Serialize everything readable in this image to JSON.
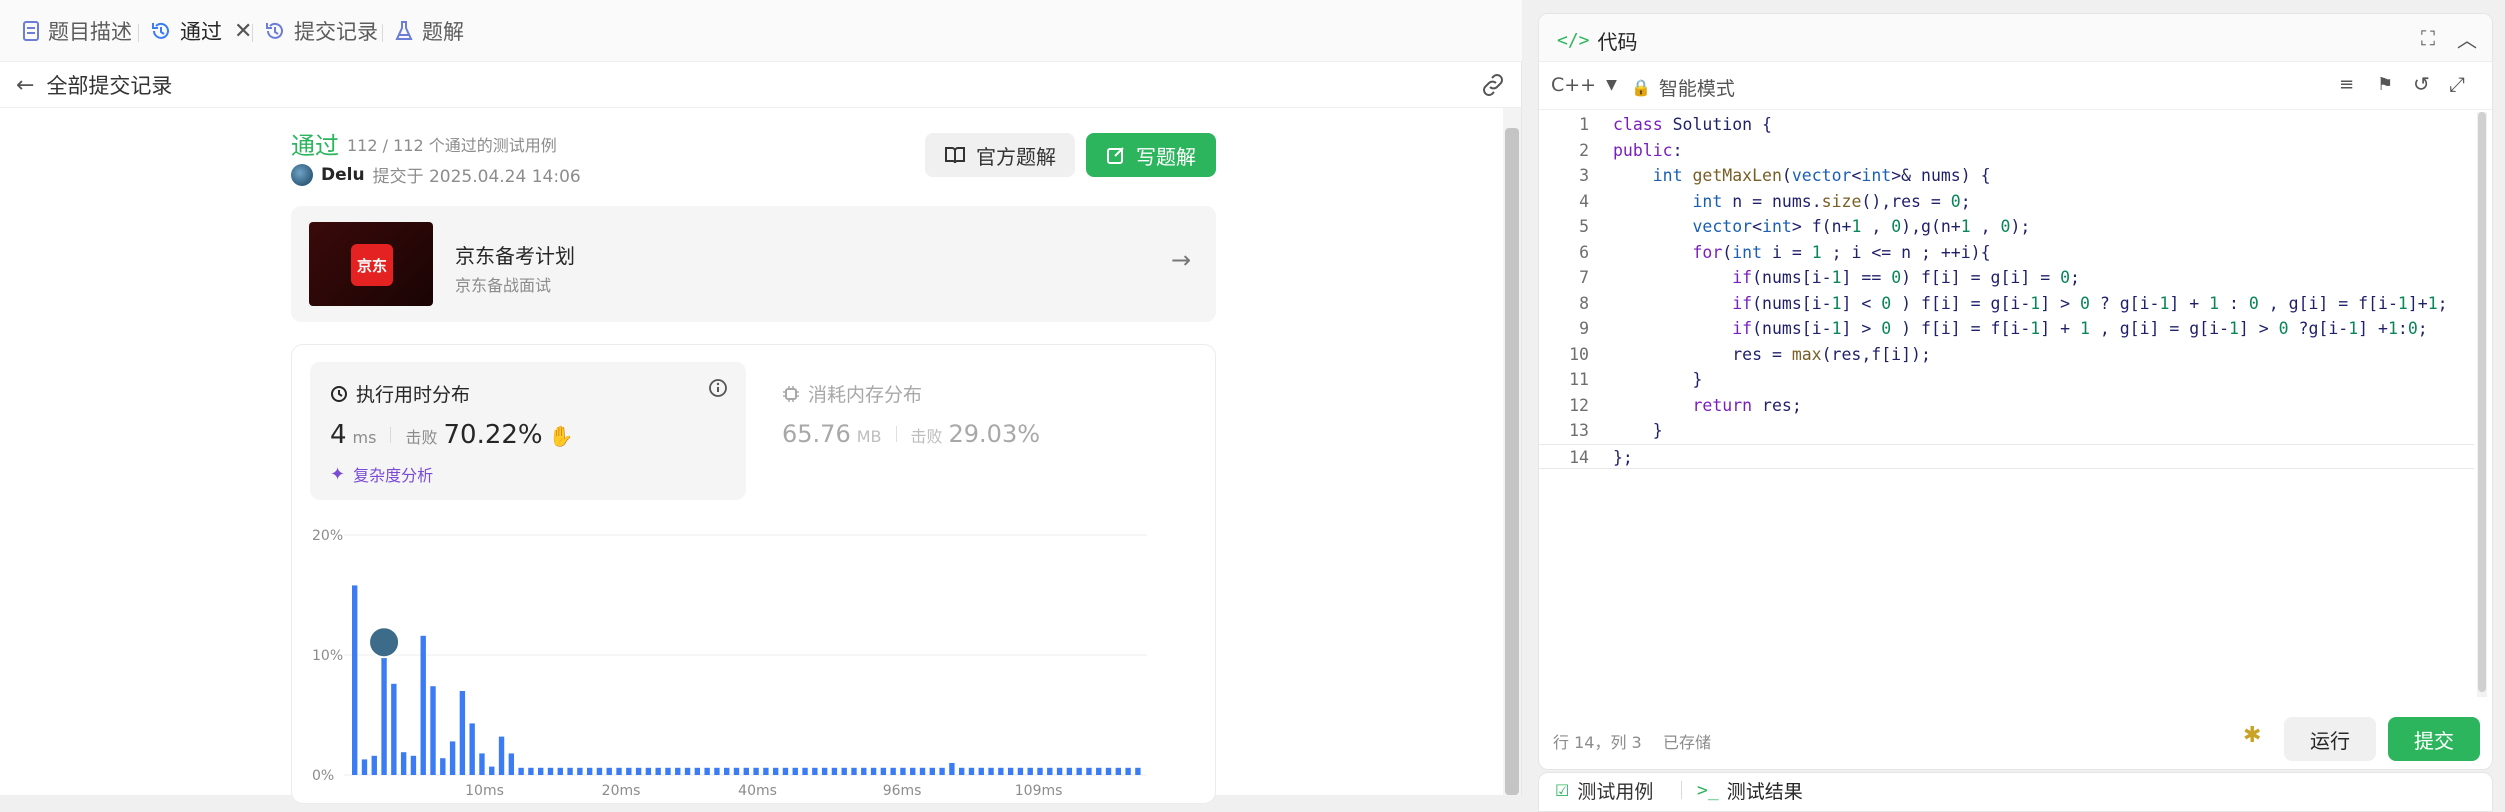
{
  "tabs": [
    {
      "label": "题目描述",
      "icon": "document-icon"
    },
    {
      "label": "通过",
      "icon": "history-icon"
    },
    {
      "label": "提交记录",
      "icon": "history-icon"
    },
    {
      "label": "题解",
      "icon": "flask-icon"
    }
  ],
  "subbar": {
    "back_label": "全部提交记录"
  },
  "result": {
    "status": "通过",
    "passed": "112 / 112 个通过的测试用例",
    "user": "Delu",
    "submitted_at": "提交于 2025.04.24 14:06",
    "official_solution_label": "官方题解",
    "write_solution_label": "写题解"
  },
  "promo": {
    "logo_text": "京东",
    "title": "京东备考计划",
    "subtitle": "京东备战面试"
  },
  "runtime": {
    "title": "执行用时分布",
    "value": "4",
    "unit": "ms",
    "beats_label": "击败",
    "beats_value": "70.22%",
    "analysis_label": "复杂度分析"
  },
  "memory": {
    "title": "消耗内存分布",
    "value": "65.76",
    "unit": "MB",
    "beats_label": "击败",
    "beats_value": "29.03%"
  },
  "colors": {
    "accent_green": "#2db55d",
    "bar_blue": "#3b7cf5",
    "status_green": "#2db55d"
  },
  "chart_data": {
    "type": "bar",
    "title": "",
    "xlabel": "",
    "ylabel": "",
    "ylim": [
      0,
      20
    ],
    "yticks": [
      "20%",
      "10%",
      "0%"
    ],
    "xticks": [
      "10ms",
      "20ms",
      "40ms",
      "96ms",
      "109ms"
    ],
    "values": [
      15.8,
      1.3,
      1.6,
      10.9,
      7.6,
      1.9,
      1.6,
      11.6,
      7.4,
      1.4,
      2.8,
      7.0,
      4.3,
      1.8,
      0.7,
      3.2,
      1.8,
      0.6,
      0.6,
      0.6,
      0.6,
      0.6,
      0.6,
      0.6,
      0.6,
      0.6,
      0.6,
      0.6,
      0.6,
      0.6,
      0.6,
      0.6,
      0.6,
      0.6,
      0.6,
      0.6,
      0.6,
      0.6,
      0.6,
      0.6,
      0.6,
      0.6,
      0.6,
      0.6,
      0.6,
      0.6,
      0.6,
      0.6,
      0.6,
      0.6,
      0.6,
      0.6,
      0.6,
      0.6,
      0.6,
      0.6,
      0.6,
      0.6,
      0.6,
      0.6,
      0.6,
      1.0,
      0.6,
      0.6,
      0.6,
      0.6,
      0.6,
      0.6,
      0.6,
      0.6,
      0.6,
      0.6,
      0.6,
      0.6,
      0.6,
      0.6,
      0.6,
      0.6,
      0.6,
      0.6,
      0.6
    ],
    "highlight_index": 3,
    "grid": true
  },
  "code_panel": {
    "title": "代码",
    "language": "C++",
    "mode": "智能模式",
    "status_position": "行 14，列 3",
    "status_saved": "已存储",
    "run_label": "运行",
    "submit_label": "提交",
    "lines": [
      "class Solution {",
      "public:",
      "    int getMaxLen(vector<int>& nums) {",
      "        int n = nums.size(),res = 0;",
      "        vector<int> f(n+1 , 0),g(n+1 , 0);",
      "        for(int i = 1 ; i <= n ; ++i){",
      "            if(nums[i-1] == 0) f[i] = g[i] = 0;",
      "            if(nums[i-1] < 0 ) f[i] = g[i-1] > 0 ? g[i-1] + 1 : 0 , g[i] = f[i-1]+1;",
      "            if(nums[i-1] > 0 ) f[i] = f[i-1] + 1 , g[i] = g[i-1] > 0 ?g[i-1] +1:0;",
      "            res = max(res,f[i]);",
      "        }",
      "        return res;",
      "    }",
      "};"
    ]
  },
  "bottom_tabs": [
    {
      "label": "测试用例"
    },
    {
      "label": "测试结果"
    }
  ]
}
